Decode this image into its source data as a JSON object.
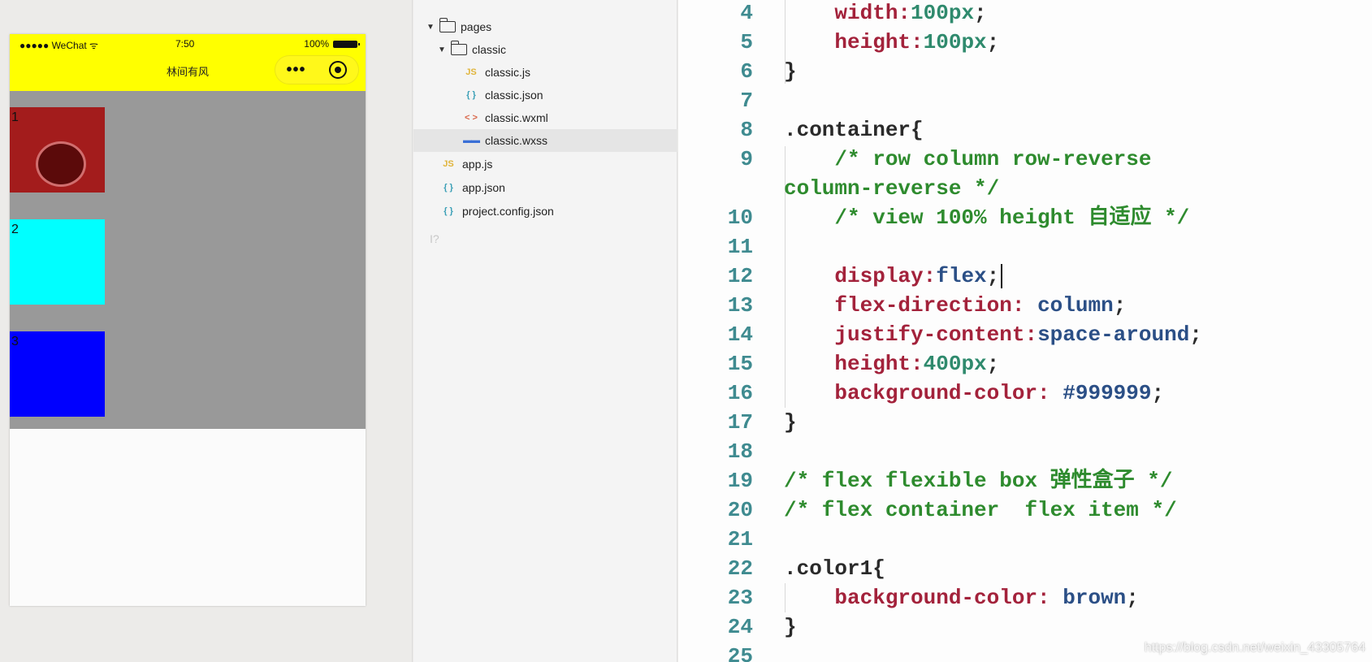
{
  "simulator": {
    "status": {
      "carrier": "●●●●● WeChat ᯤ",
      "time": "7:50",
      "battery_text": "100%"
    },
    "nav": {
      "title": "林间有风",
      "more_glyph": "•••",
      "nav_bg": "#ffff00"
    },
    "container_bg": "#999999",
    "items": [
      {
        "label": "1",
        "color": "#a31c1c"
      },
      {
        "label": "2",
        "color": "#00ffff"
      },
      {
        "label": "3",
        "color": "#0000ff"
      }
    ]
  },
  "file_tree": {
    "folders": [
      {
        "label": "pages",
        "icon": "folder-icon"
      },
      {
        "label": "classic",
        "icon": "folder-icon"
      }
    ],
    "files": [
      {
        "label": "classic.js",
        "icon_glyph": "JS",
        "icon": "js-file-icon"
      },
      {
        "label": "classic.json",
        "icon_glyph": "{ }",
        "icon": "json-file-icon"
      },
      {
        "label": "classic.wxml",
        "icon_glyph": "< >",
        "icon": "wxml-file-icon"
      },
      {
        "label": "classic.wxss",
        "icon_glyph": "▬▬",
        "icon": "wxss-file-icon",
        "selected": true
      },
      {
        "label": "app.js",
        "icon_glyph": "JS",
        "icon": "js-file-icon"
      },
      {
        "label": "app.json",
        "icon_glyph": "{ }",
        "icon": "json-file-icon"
      },
      {
        "label": "project.config.json",
        "icon_glyph": "{ }",
        "icon": "json-file-icon"
      }
    ],
    "cursor_glyph": "I?"
  },
  "editor": {
    "lines": [
      {
        "n": "4",
        "t": [
          [
            "p",
            "    width:"
          ],
          [
            "n",
            "100px"
          ],
          [
            "s",
            ";"
          ]
        ]
      },
      {
        "n": "5",
        "t": [
          [
            "p",
            "    height:"
          ],
          [
            "n",
            "100px"
          ],
          [
            "s",
            ";"
          ]
        ]
      },
      {
        "n": "6",
        "t": [
          [
            "b",
            "}"
          ]
        ]
      },
      {
        "n": "7",
        "t": []
      },
      {
        "n": "8",
        "t": [
          [
            "b",
            ".container{"
          ]
        ]
      },
      {
        "n": "9",
        "t": [
          [
            "c",
            "    /* row column row-reverse"
          ]
        ]
      },
      {
        "n": "",
        "t": [
          [
            "c",
            "column-reverse */"
          ]
        ]
      },
      {
        "n": "10",
        "t": [
          [
            "c",
            "    /* view 100% height 自适应 */"
          ]
        ]
      },
      {
        "n": "11",
        "t": []
      },
      {
        "n": "12",
        "t": [
          [
            "p",
            "    display:"
          ],
          [
            "v",
            "flex"
          ],
          [
            "s",
            ";"
          ]
        ],
        "caret": true
      },
      {
        "n": "13",
        "t": [
          [
            "p",
            "    flex-direction: "
          ],
          [
            "v",
            "column"
          ],
          [
            "s",
            ";"
          ]
        ]
      },
      {
        "n": "14",
        "t": [
          [
            "p",
            "    justify-content:"
          ],
          [
            "v",
            "space-around"
          ],
          [
            "s",
            ";"
          ]
        ]
      },
      {
        "n": "15",
        "t": [
          [
            "p",
            "    height:"
          ],
          [
            "n",
            "400px"
          ],
          [
            "s",
            ";"
          ]
        ]
      },
      {
        "n": "16",
        "t": [
          [
            "p",
            "    background-color: "
          ],
          [
            "v",
            "#999999"
          ],
          [
            "s",
            ";"
          ]
        ]
      },
      {
        "n": "17",
        "t": [
          [
            "b",
            "}"
          ]
        ]
      },
      {
        "n": "18",
        "t": []
      },
      {
        "n": "19",
        "t": [
          [
            "c",
            "/* flex flexible box 弹性盒子 */"
          ]
        ]
      },
      {
        "n": "20",
        "t": [
          [
            "c",
            "/* flex container  flex item */"
          ]
        ]
      },
      {
        "n": "21",
        "t": []
      },
      {
        "n": "22",
        "t": [
          [
            "b",
            ".color1{"
          ]
        ]
      },
      {
        "n": "23",
        "t": [
          [
            "p",
            "    background-color: "
          ],
          [
            "v",
            "brown"
          ],
          [
            "s",
            ";"
          ]
        ]
      },
      {
        "n": "24",
        "t": [
          [
            "b",
            "}"
          ]
        ]
      },
      {
        "n": "25",
        "t": []
      }
    ],
    "watermark": "https://blog.csdn.net/weixin_43305764"
  }
}
